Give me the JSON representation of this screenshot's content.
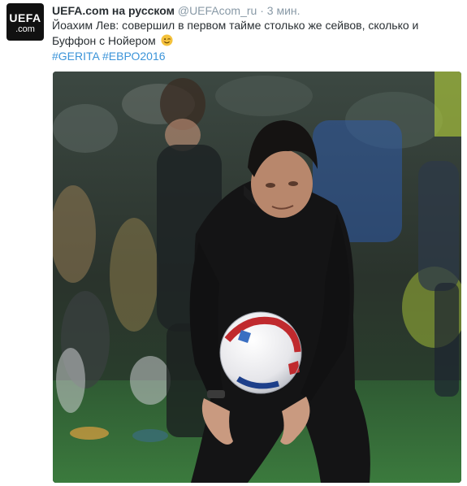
{
  "tweet": {
    "display_name": "UEFA.com на русском",
    "username": "@UEFAcom_ru",
    "separator": "·",
    "timestamp": "3 мин.",
    "text": "Йоахим Лев: совершил в первом тайме столько же сейвов, сколько и Буффон с Нойером",
    "hashtags": [
      "#GERITA",
      "#ЕВРО2016"
    ],
    "emoji": "winking-face"
  },
  "avatar": {
    "line1": "UEFA",
    "line2": ".com"
  },
  "colors": {
    "link": "#3b94d9",
    "meta": "#8899a6",
    "text": "#292f33"
  }
}
